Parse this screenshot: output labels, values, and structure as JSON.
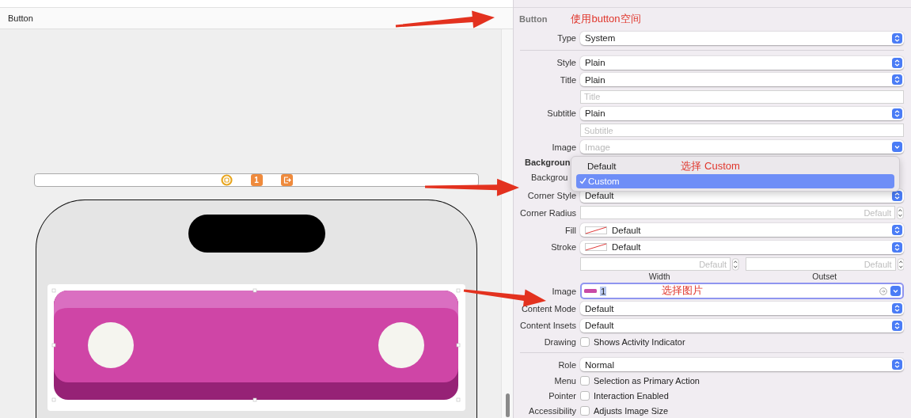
{
  "editor": {
    "breadcrumb": "Button",
    "scene_dock": {
      "badge": "1"
    }
  },
  "inspector": {
    "section": "Button",
    "note": "使用button空间",
    "rows": [
      {
        "kind": "popup",
        "label": "Type",
        "value": "System"
      },
      {
        "kind": "divider"
      },
      {
        "kind": "popup",
        "label": "Style",
        "value": "Plain"
      },
      {
        "kind": "popup",
        "label": "Title",
        "value": "Plain"
      },
      {
        "kind": "field",
        "placeholder": "Title"
      },
      {
        "kind": "popup",
        "label": "Subtitle",
        "value": "Plain"
      },
      {
        "kind": "field",
        "placeholder": "Subtitle"
      },
      {
        "kind": "pulldown",
        "label": "Image",
        "placeholder": "Image"
      },
      {
        "kind": "heading",
        "label": "Backgroun"
      },
      {
        "kind": "covered",
        "label": "Backgrou"
      },
      {
        "kind": "popup",
        "label": "Corner Style",
        "value": "Default"
      },
      {
        "kind": "stepper",
        "label": "Corner Radius",
        "placeholder": "Default"
      },
      {
        "kind": "swatch",
        "label": "Fill",
        "value": "Default"
      },
      {
        "kind": "swatch",
        "label": "Stroke",
        "value": "Default"
      },
      {
        "kind": "stepper_pair",
        "fields": [
          {
            "placeholder": "Default",
            "caption": "Width"
          },
          {
            "placeholder": "Default",
            "caption": "Outset"
          }
        ]
      },
      {
        "kind": "image_field",
        "label": "Image",
        "value": "1",
        "focused": true,
        "note": "选择图片"
      },
      {
        "kind": "popup",
        "label": "Content Mode",
        "value": "Default"
      },
      {
        "kind": "popup",
        "label": "Content Insets",
        "value": "Default"
      },
      {
        "kind": "checkbox",
        "label": "Drawing",
        "text": "Shows Activity Indicator",
        "checked": false
      },
      {
        "kind": "divider"
      },
      {
        "kind": "popup",
        "label": "Role",
        "value": "Normal"
      },
      {
        "kind": "checkbox",
        "label": "Menu",
        "text": "Selection as Primary Action",
        "checked": false
      },
      {
        "kind": "checkbox",
        "label": "Pointer",
        "text": "Interaction Enabled",
        "checked": false
      },
      {
        "kind": "checkbox",
        "label": "Accessibility",
        "text": "Adjusts Image Size",
        "checked": false
      }
    ]
  },
  "menu": {
    "note": "选择 Custom",
    "items": [
      {
        "label": "Default",
        "selected": false
      },
      {
        "label": "Custom",
        "selected": true
      }
    ]
  }
}
